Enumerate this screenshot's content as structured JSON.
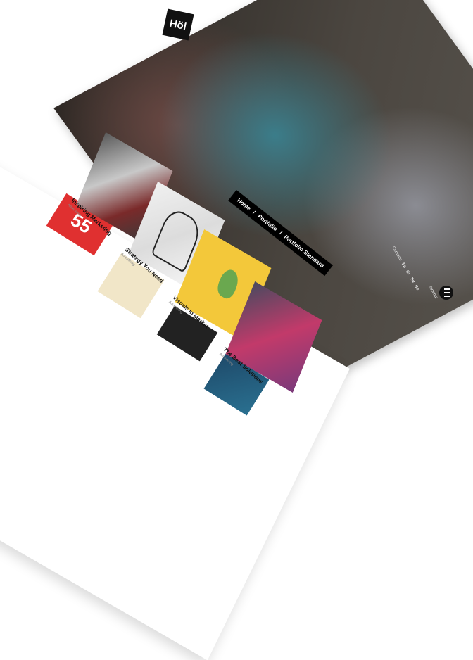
{
  "site": {
    "logo": "Höl"
  },
  "hero": {
    "breadcrumb": [
      "Home",
      "/",
      "Portfolio",
      "/",
      "Portfolio Standard"
    ],
    "contact_label": "Contact:",
    "social_links": [
      "Fb",
      "Gr",
      "Tw",
      "Be"
    ],
    "sidebar_label": "Sidebar"
  },
  "portfolio": {
    "items": [
      {
        "title": "Inspiring Marketing",
        "category": "Advertising"
      },
      {
        "title": "Strategy You Need",
        "category": "Advertising"
      },
      {
        "title": "Visuals in Market",
        "category": "Advertising"
      },
      {
        "title": "The Best Solutions",
        "category": "Advertising"
      }
    ],
    "partial_tile_text": "55"
  }
}
